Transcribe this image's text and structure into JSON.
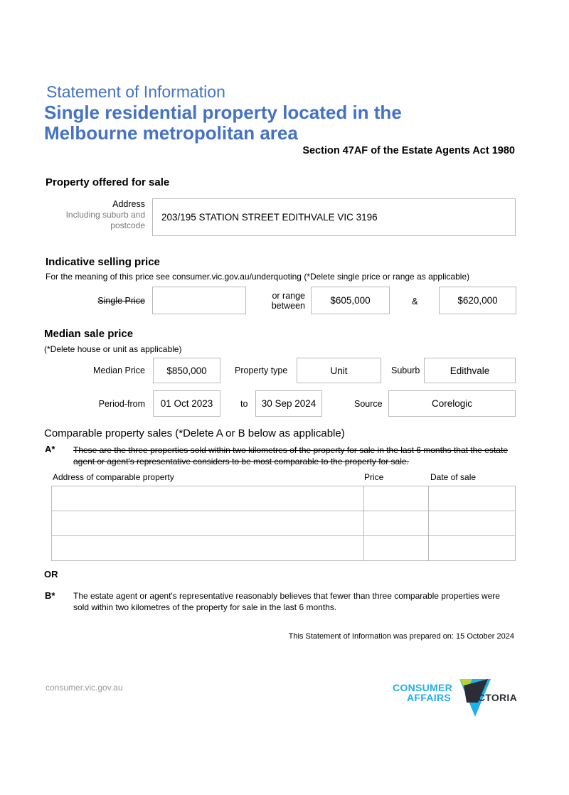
{
  "header": {
    "doc_label": "Statement of Information",
    "title": "Single residential property located in the Melbourne metropolitan area",
    "act_reference": "Section 47AF of the Estate Agents Act 1980"
  },
  "property": {
    "heading": "Property offered for sale",
    "address_label": "Address",
    "address_sublabel_1": "Including suburb and",
    "address_sublabel_2": "postcode",
    "address_value": "203/195 STATION STREET EDITHVALE VIC 3196"
  },
  "indicative": {
    "heading": "Indicative selling price",
    "note": "For the meaning of this price see consumer.vic.gov.au/underquoting (*Delete single price or range as applicable)",
    "single_price_label": "Single Price",
    "single_price_value": "",
    "range_label_1": "or range",
    "range_label_2": "between",
    "range_low": "$605,000",
    "range_sep": "&",
    "range_high": "$620,000"
  },
  "median": {
    "heading": "Median sale price",
    "note": "(*Delete house or unit as applicable)",
    "median_price_label": "Median Price",
    "median_price_value": "$850,000",
    "property_type_label": "Property type",
    "property_type_value": "Unit",
    "suburb_label": "Suburb",
    "suburb_value": "Edithvale",
    "period_from_label": "Period-from",
    "period_from_value": "01 Oct 2023",
    "to_label": "to",
    "period_to_value": "30 Sep 2024",
    "source_label": "Source",
    "source_value": "Corelogic"
  },
  "comparable": {
    "heading": "Comparable property sales (*Delete A or B below as applicable)",
    "a_marker": "A*",
    "a_text": "These are the three properties sold within two kilometres of the property for sale in the last 6 months that the estate agent or agent's representative considers to be most comparable to the property for sale.",
    "columns": [
      "Address of comparable property",
      "Price",
      "Date of sale"
    ],
    "rows": [
      [
        "",
        "",
        ""
      ],
      [
        "",
        "",
        ""
      ],
      [
        "",
        "",
        ""
      ]
    ],
    "or_label": "OR",
    "b_marker": "B*",
    "b_text": "The estate agent or agent's representative reasonably believes that fewer than three comparable properties were sold within two kilometres of the property for sale in the last 6 months."
  },
  "prepared": "This Statement of Information was prepared on: 15 October 2024",
  "footer": {
    "website": "consumer.vic.gov.au",
    "logo_line1": "CONSUMER",
    "logo_line2": "AFFAIRS",
    "logo_word": "VICTORIA"
  },
  "colors": {
    "brand_blue": "#4472C4",
    "logo_cyan": "#1EB1E7",
    "logo_lime": "#B5D334",
    "logo_dark": "#2B2D36"
  }
}
